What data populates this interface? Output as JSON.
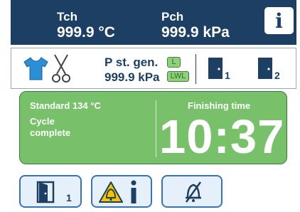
{
  "header": {
    "tch_label": "Tch",
    "tch_value": "999.9 °C",
    "pch_label": "Pch",
    "pch_value": "999.9 kPa",
    "info_label": "i"
  },
  "status": {
    "p_st_gen_label": "P st. gen.",
    "p_st_gen_value": "999.9 kPa",
    "tag_l": "L",
    "tag_lwl": "LWL",
    "door1_num": "1",
    "door2_num": "2"
  },
  "cycle": {
    "program": "Standard 134 °C",
    "state": "Cycle complete",
    "finishing_label": "Finishing time",
    "finishing_time": "10:37"
  },
  "buttons": {
    "door_num": "1"
  },
  "colors": {
    "header_bg": "#1c3f63",
    "panel_green": "#78c16a",
    "button_border": "#3b73b0",
    "alarm_yellow": "#f7c300"
  },
  "icons": {
    "info": "info-icon",
    "cloth": "tshirt-icon",
    "scissors": "scissors-icon",
    "door": "door-icon",
    "alarm": "alarm-bell-icon",
    "mute": "muted-bell-icon"
  }
}
